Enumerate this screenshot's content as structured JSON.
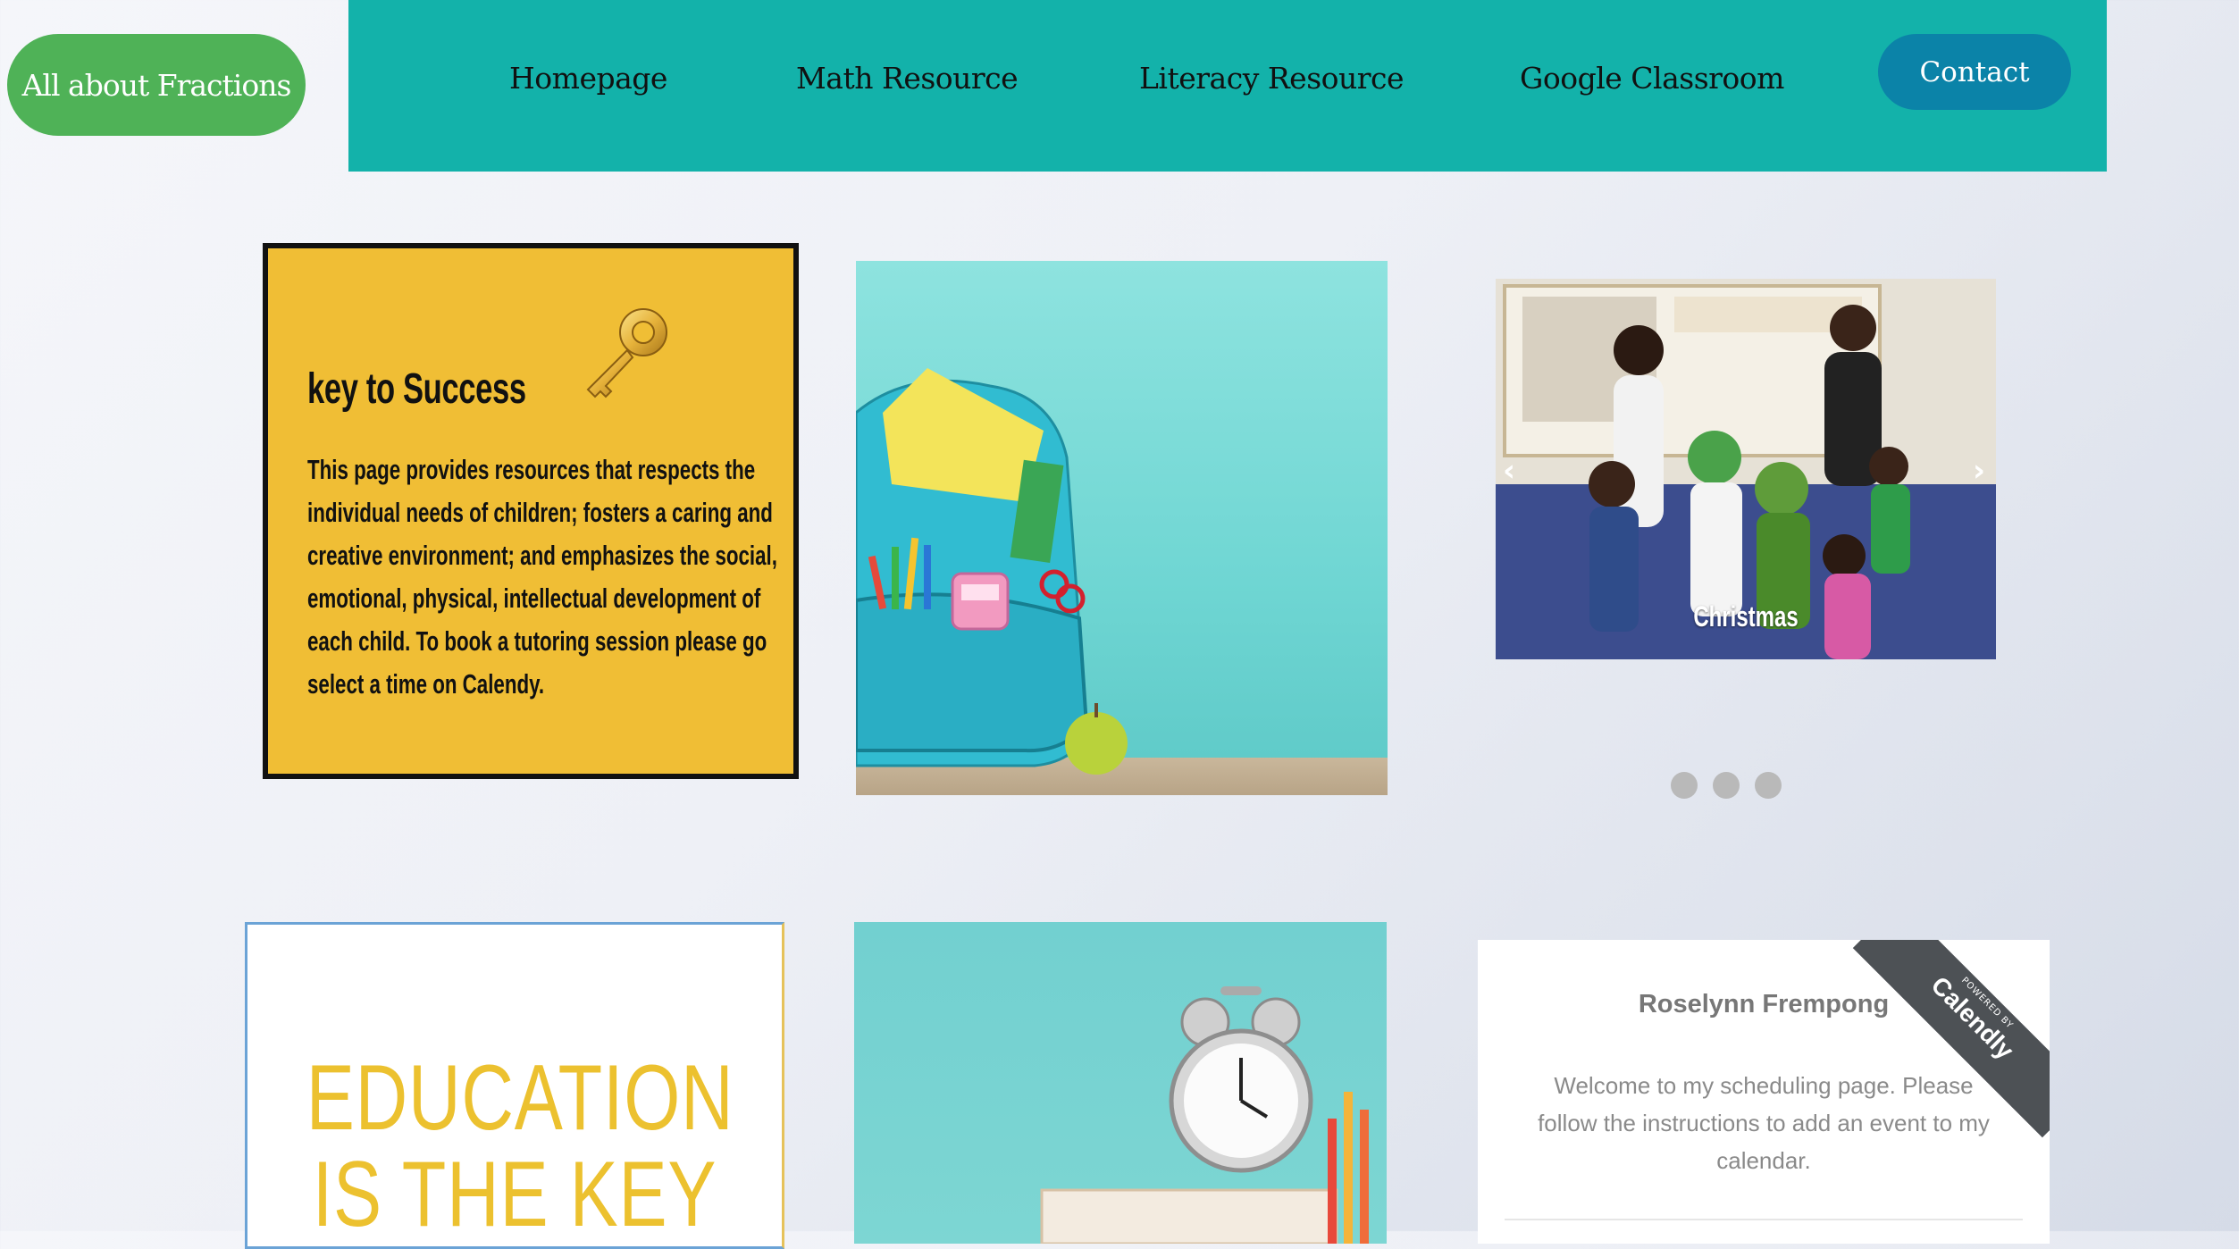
{
  "header": {
    "site_button": "All about Fractions",
    "nav": [
      "Homepage",
      "Math Resource",
      "Literacy Resource",
      "Google Classroom"
    ],
    "contact": "Contact"
  },
  "key_card": {
    "title": "key to Success",
    "icon": "key-icon",
    "body": "This page provides resources that respects the individual needs of children; fosters a caring and creative environment; and emphasizes the social, emotional, physical, intellectual development of each child. To book a tutoring session please go select a time on Calendy."
  },
  "carousel": {
    "caption": "Christmas",
    "prev": "‹",
    "next": "›",
    "slides": 3
  },
  "education_card": {
    "line1": "EDUCATION",
    "line2": "IS THE KEY"
  },
  "calendly": {
    "name": "Roselynn Frempong",
    "welcome": "Welcome to my scheduling page. Please follow the instructions to add an event to my calendar.",
    "ribbon_small": "POWERED BY",
    "ribbon_brand": "Calendly"
  },
  "colors": {
    "nav_bg": "#13b2aa",
    "pill_green": "#4fb257",
    "contact_blue": "#0b83a8",
    "card_yellow": "#f0be35"
  }
}
